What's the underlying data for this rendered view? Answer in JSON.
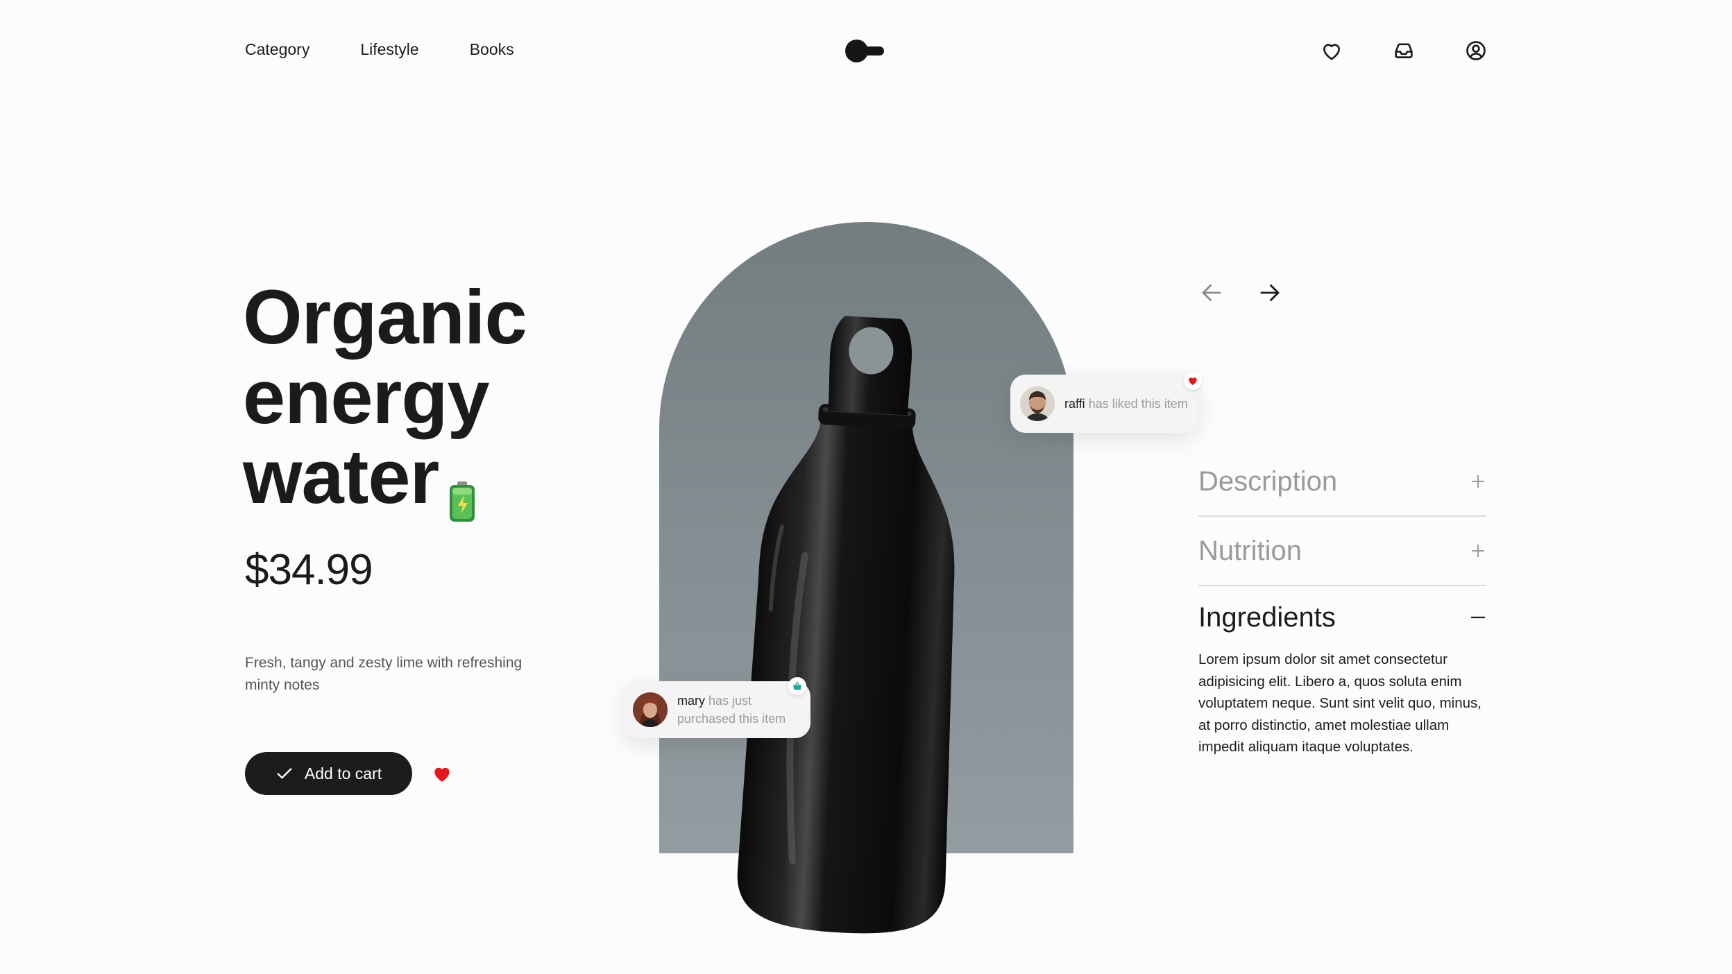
{
  "nav": {
    "items": [
      {
        "label": "Category"
      },
      {
        "label": "Lifestyle"
      },
      {
        "label": "Books"
      }
    ]
  },
  "header_icons": [
    "heart-icon",
    "inbox-icon",
    "user-icon"
  ],
  "product": {
    "title_lines": [
      "Organic",
      "energy",
      "water"
    ],
    "title_emoji": "battery-icon",
    "price": "$34.99",
    "tagline": "Fresh, tangy and zesty lime with refreshing minty notes",
    "cart_button": "Add to cart"
  },
  "activity": {
    "like": {
      "user": "raffi",
      "text": " has liked this item"
    },
    "purchase": {
      "user": "mary",
      "text": " has just purchased this item"
    }
  },
  "accordion": {
    "sections": [
      {
        "label": "Description",
        "state": "collapsed"
      },
      {
        "label": "Nutrition",
        "state": "collapsed"
      },
      {
        "label": "Ingredients",
        "state": "expanded"
      }
    ],
    "ingredients_text": "Lorem ipsum dolor sit amet consectetur adipisicing elit. Libero a, quos soluta enim voluptatem neque. Sunt sint velit quo, minus, at porro distinctio, amet molestiae ullam impedit aliquam itaque voluptates."
  },
  "colors": {
    "primary": "#1c1c1c",
    "accent_red": "#e3181e",
    "arch": "#7f898c",
    "muted_text": "#9a9a9a",
    "basket_teal": "#1aa79c"
  }
}
